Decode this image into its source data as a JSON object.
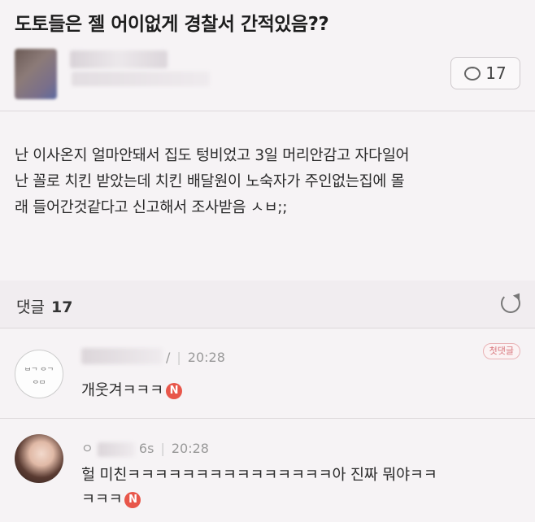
{
  "post": {
    "title": "도토들은 젤 어이없게 경찰서 간적있음??",
    "comment_count": "17",
    "body_lines": [
      "난 이사온지 얼마안돼서 집도 텅비었고 3일 머리안감고 자다일어",
      "난 꼴로 치킨 받았는데 치킨 배달원이 노숙자가 주인없는집에 몰",
      "래 들어간것같다고 신고해서 조사받음 ㅅㅂ;;"
    ]
  },
  "comments_section": {
    "label": "댓글",
    "count": "17"
  },
  "comments": [
    {
      "avatar_text_top": "ᄇᄀ ᄋᄀ",
      "avatar_text_bottom": "ᄋᄆ",
      "name_suffix": "/",
      "time": "20:28",
      "badge": "첫댓글",
      "text": "개웃겨ㅋㅋㅋ",
      "new_badge": "N"
    },
    {
      "name_prefix": "ㅇ",
      "name_suffix": "6s",
      "time": "20:28",
      "text_line1": "헐 미친ㅋㅋㅋㅋㅋㅋㅋㅋㅋㅋㅋㅋㅋㅋㅋ아 진짜 뭐야ㅋㅋ",
      "text_line2": "ㅋㅋㅋ",
      "new_badge": "N"
    }
  ],
  "icons": {
    "comment": "speech-bubble-icon",
    "refresh": "refresh-icon",
    "new": "new-badge-icon"
  },
  "colors": {
    "background": "#f6f3f5",
    "new_badge": "#e8564a",
    "first_badge": "#d8767c"
  }
}
